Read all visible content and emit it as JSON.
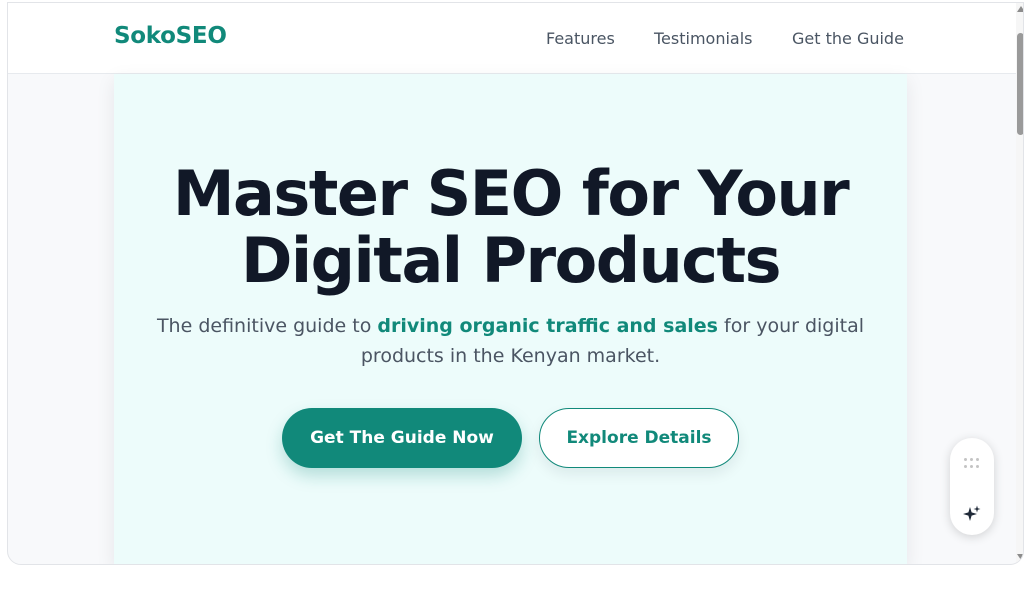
{
  "nav": {
    "brand": "SokoSEO",
    "links": [
      "Features",
      "Testimonials",
      "Get the Guide"
    ]
  },
  "hero": {
    "title_line1": "Master SEO for Your",
    "title_line2": "Digital Products",
    "subtitle_before": "The definitive guide to ",
    "subtitle_highlight": "driving organic traffic and sales",
    "subtitle_after": " for your digital products in the Kenyan market.",
    "primary_button": "Get The Guide Now",
    "secondary_button": "Explore Details"
  },
  "widget": {
    "drag_icon": "drag-handle-icon",
    "action_icon": "sparkle-icon"
  },
  "colors": {
    "accent": "#11897a",
    "hero_bg": "#edfcfb",
    "title": "#111827",
    "text": "#4b5563"
  }
}
